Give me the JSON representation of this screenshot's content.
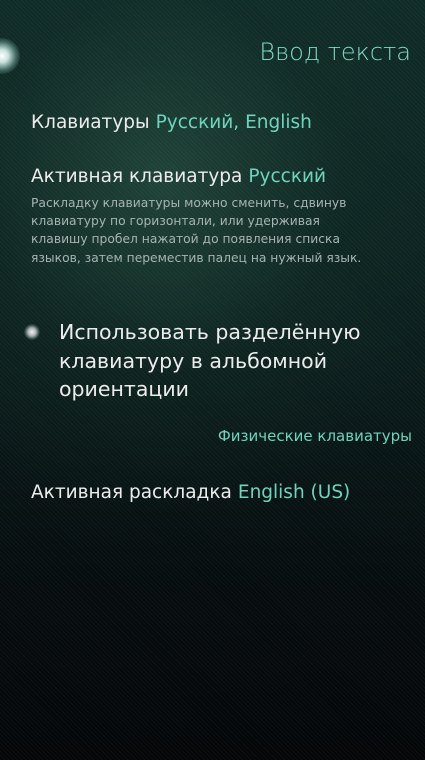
{
  "page": {
    "title": "Ввод текста"
  },
  "keyboards": {
    "label": "Клавиатуры",
    "value": "Русский, English"
  },
  "active_keyboard": {
    "label": "Активная клавиатура",
    "value": "Русский",
    "hint_lines": [
      "Раскладку клавиатуры можно сменить, сдвинув",
      "клавиатуру по горизонтали, или удерживая",
      "клавишу пробел нажатой до появления списка",
      "языков, затем переместив палец на нужный язык."
    ]
  },
  "split_keyboard": {
    "label_lines": [
      "Использовать разделённую",
      "клавиатуру в альбомной",
      "ориентации"
    ],
    "enabled": false
  },
  "physical_keyboards": {
    "section_title": "Физические клавиатуры",
    "active_layout_label": "Активная раскладка",
    "active_layout_value": "English (US)"
  },
  "colors": {
    "accent": "#6fd3bd",
    "title": "#7fd8c4",
    "text": "#ececec",
    "hint": "#a7b4b2",
    "background_top": "#0f2b28",
    "background_bottom": "#040608"
  }
}
